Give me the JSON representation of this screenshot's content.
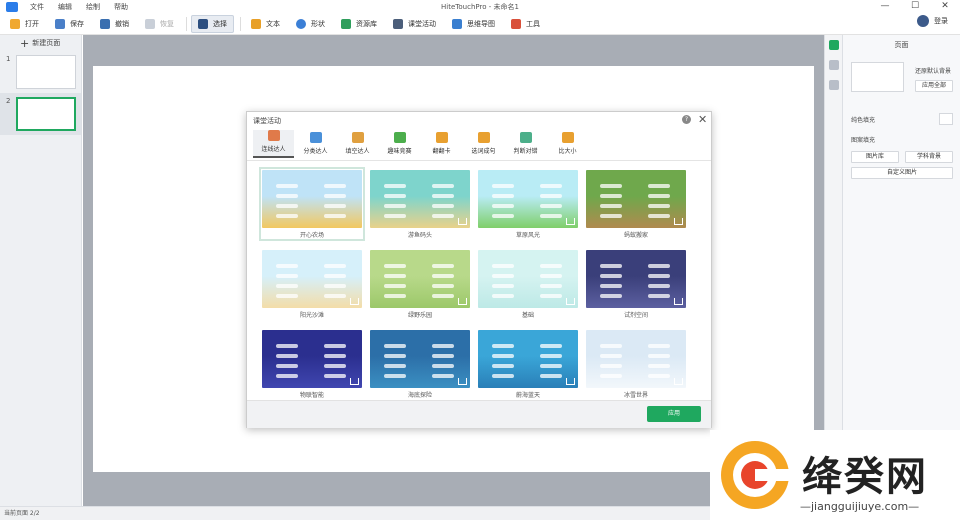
{
  "window": {
    "title": "HiteTouchPro - 未命名1",
    "menu": [
      "文件",
      "编辑",
      "绘制",
      "帮助"
    ],
    "controls": [
      "—",
      "☐",
      "✕"
    ]
  },
  "toolbar": {
    "open": "打开",
    "save": "保存",
    "undo": "撤销",
    "redo": "恢复",
    "select": "选择",
    "text": "文本",
    "shape": "形状",
    "resources": "资源库",
    "activity": "课堂活动",
    "mindmap": "思维导图",
    "tools": "工具",
    "login": "登录"
  },
  "leftpanel": {
    "new_page": "新建页面",
    "pages": [
      "1",
      "2"
    ]
  },
  "rightpanel": {
    "title": "页面",
    "restore_bg": "还原默认背景",
    "apply_all": "应用全部",
    "solid_fill": "纯色填充",
    "image_fill": "图案填充",
    "gallery": "图片库",
    "subject_bg": "学科背景",
    "custom_image": "自定义图片"
  },
  "statusbar": {
    "text": "当前页面 2/2"
  },
  "dialog": {
    "title": "课堂活动",
    "help": "?",
    "close": "✕",
    "tabs": [
      "连线达人",
      "分类达人",
      "填空达人",
      "趣味竞赛",
      "翻翻卡",
      "选词成句",
      "判断对错",
      "比大小"
    ],
    "templates": [
      {
        "label": "开心农场",
        "bg1": "#bfe3f7",
        "bg2": "#f2c860"
      },
      {
        "label": "游鱼码头",
        "bg1": "#7ed4cc",
        "bg2": "#e9d28a"
      },
      {
        "label": "草原风光",
        "bg1": "#b9ecf5",
        "bg2": "#7fcf6a"
      },
      {
        "label": "蚂蚁搬家",
        "bg1": "#6fa84c",
        "bg2": "#b08a4e"
      },
      {
        "label": "阳光沙滩",
        "bg1": "#d6f0fa",
        "bg2": "#f3dda8"
      },
      {
        "label": "绿野乐园",
        "bg1": "#b8d98a",
        "bg2": "#9cc86a"
      },
      {
        "label": "基础",
        "bg1": "#d5f3f1",
        "bg2": "#bde9e6"
      },
      {
        "label": "试剂空间",
        "bg1": "#3a3f7a",
        "bg2": "#5c5fa0"
      },
      {
        "label": "物联智能",
        "bg1": "#2b2f8f",
        "bg2": "#4046b0"
      },
      {
        "label": "海底探险",
        "bg1": "#2c6fa8",
        "bg2": "#3b8fc2"
      },
      {
        "label": "蔚海蓝天",
        "bg1": "#3aa6d8",
        "bg2": "#2a7fb8"
      },
      {
        "label": "冰雪世界",
        "bg1": "#dbe9f5",
        "bg2": "#f2f7fb"
      }
    ],
    "apply": "应用"
  },
  "watermark": {
    "text": "绛癸网",
    "url": "—jiangguijiuye.com—"
  }
}
